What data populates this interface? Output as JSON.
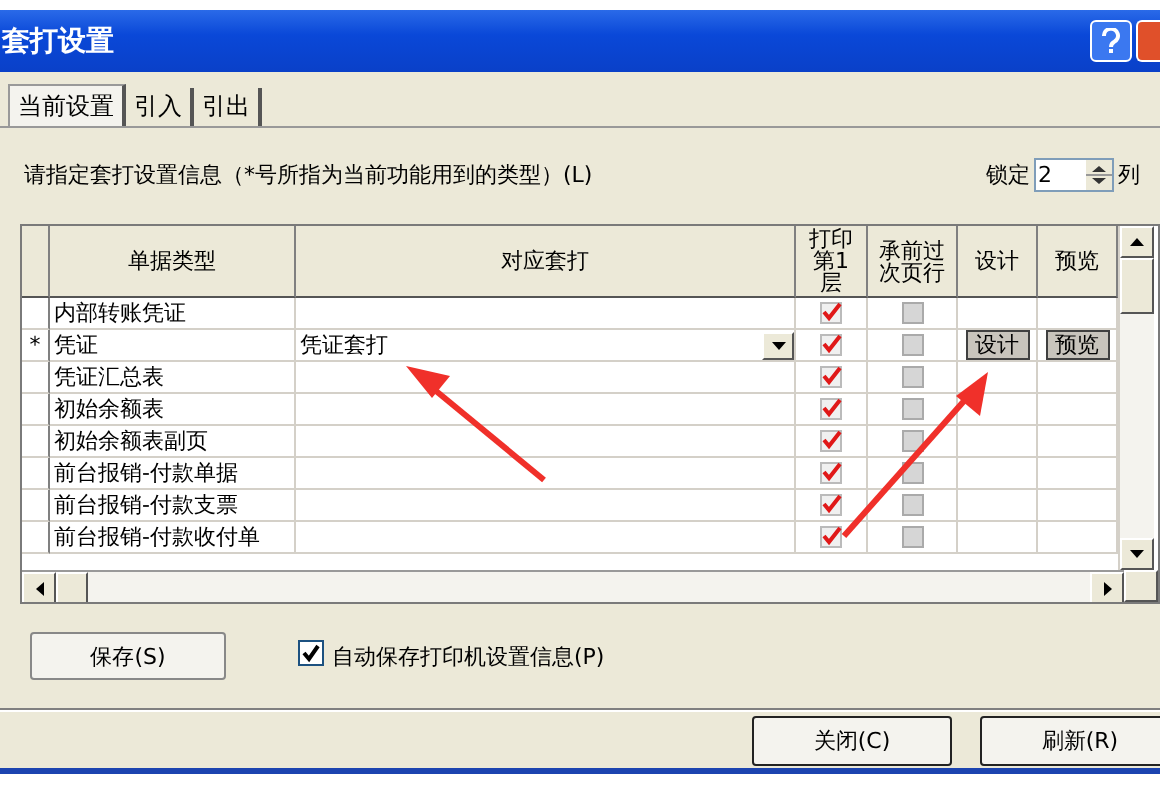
{
  "window": {
    "title": "套打设置"
  },
  "tabs": [
    {
      "label": "当前设置",
      "selected": true
    },
    {
      "label": "引入",
      "selected": false
    },
    {
      "label": "引出",
      "selected": false
    }
  ],
  "instruction": "请指定套打设置信息（*号所指为当前功能用到的类型）(L)",
  "lock": {
    "label": "锁定",
    "value": "2",
    "unit": "列"
  },
  "table": {
    "columns": [
      "单据类型",
      "对应套打",
      "打印第1层",
      "承前过次页行",
      "设计",
      "预览"
    ],
    "rows": [
      {
        "marker": "",
        "type": "内部转账凭证",
        "template": "",
        "print_first": true,
        "carry_over": {
          "checked": false,
          "disabled": true
        },
        "actions": []
      },
      {
        "marker": "*",
        "type": "凭证",
        "template": "凭证套打",
        "dropdown": true,
        "print_first": true,
        "carry_over": {
          "checked": false,
          "disabled": true
        },
        "actions": [
          "设计",
          "预览"
        ]
      },
      {
        "marker": "",
        "type": "凭证汇总表",
        "template": "",
        "print_first": true,
        "carry_over": {
          "checked": false,
          "disabled": true
        },
        "actions": []
      },
      {
        "marker": "",
        "type": "初始余额表",
        "template": "",
        "print_first": true,
        "carry_over": {
          "checked": false,
          "disabled": true
        },
        "actions": []
      },
      {
        "marker": "",
        "type": "初始余额表副页",
        "template": "",
        "print_first": true,
        "carry_over": {
          "checked": false,
          "disabled": true
        },
        "actions": []
      },
      {
        "marker": "",
        "type": "前台报销-付款单据",
        "template": "",
        "print_first": true,
        "carry_over": {
          "checked": false,
          "disabled": true
        },
        "actions": []
      },
      {
        "marker": "",
        "type": "前台报销-付款支票",
        "template": "",
        "print_first": true,
        "carry_over": {
          "checked": false,
          "disabled": true
        },
        "actions": []
      },
      {
        "marker": "",
        "type": "前台报销-付款收付单",
        "template": "",
        "print_first": true,
        "carry_over": {
          "checked": false,
          "disabled": true
        },
        "actions": []
      }
    ]
  },
  "save_button": "保存(S)",
  "auto_save": {
    "label": "自动保存打印机设置信息(P)",
    "checked": true
  },
  "buttons": [
    "关闭(C)",
    "刷新(R)"
  ]
}
